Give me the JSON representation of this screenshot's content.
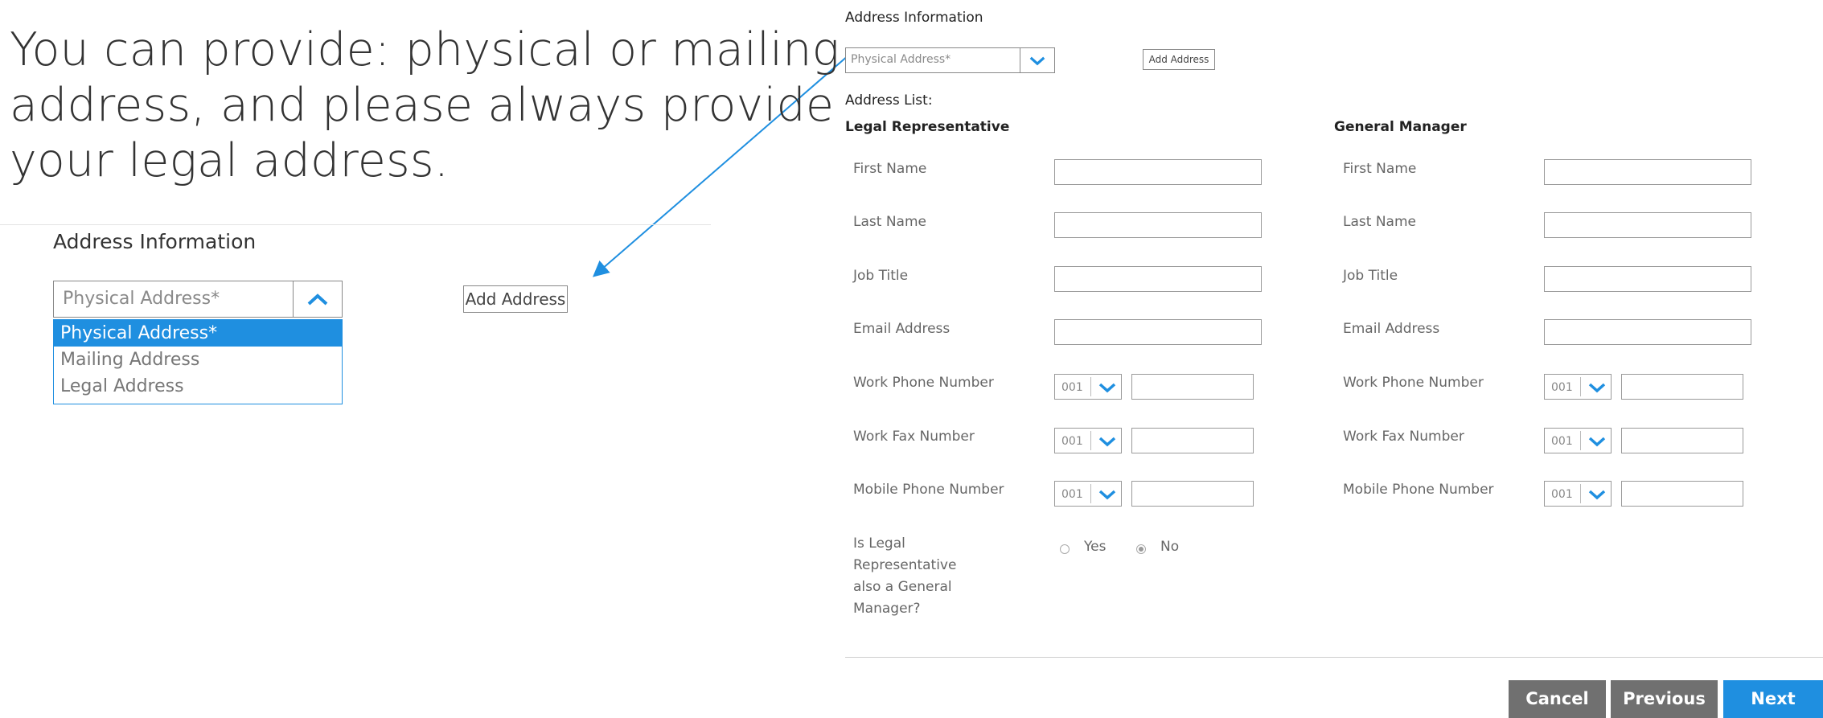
{
  "callout": {
    "lines": [
      "You can provide: physical or mailing",
      "address, and please always provide",
      "your legal address."
    ]
  },
  "zoomed": {
    "title": "Address Information",
    "select_value": "Physical Address*",
    "options": [
      "Physical Address*",
      "Mailing Address",
      "Legal Address"
    ],
    "add_button": "Add Address"
  },
  "form": {
    "title": "Address Information",
    "address_type": "Physical Address*",
    "add_button": "Add Address",
    "address_list_label": "Address List:",
    "legal": {
      "heading": "Legal Representative",
      "fields": [
        "First Name",
        "Last Name",
        "Job Title",
        "Email Address"
      ],
      "phones": [
        "Work Phone Number",
        "Work Fax Number",
        "Mobile Phone Number"
      ],
      "phone_code": "001"
    },
    "gm": {
      "heading": "General Manager",
      "fields": [
        "First Name",
        "Last Name",
        "Job Title",
        "Email Address"
      ],
      "phones": [
        "Work Phone Number",
        "Work Fax Number",
        "Mobile Phone Number"
      ],
      "phone_code": "001"
    },
    "question": {
      "lines": [
        "Is Legal",
        "Representative",
        "also a General",
        "Manager?"
      ],
      "yes_label": "Yes",
      "no_label": "No",
      "selected": "No"
    },
    "buttons": {
      "cancel": "Cancel",
      "previous": "Previous",
      "next": "Next"
    }
  },
  "colors": {
    "accent": "#1f8fe0",
    "button_gray": "#707070",
    "arrow": "#1f8fe0"
  }
}
